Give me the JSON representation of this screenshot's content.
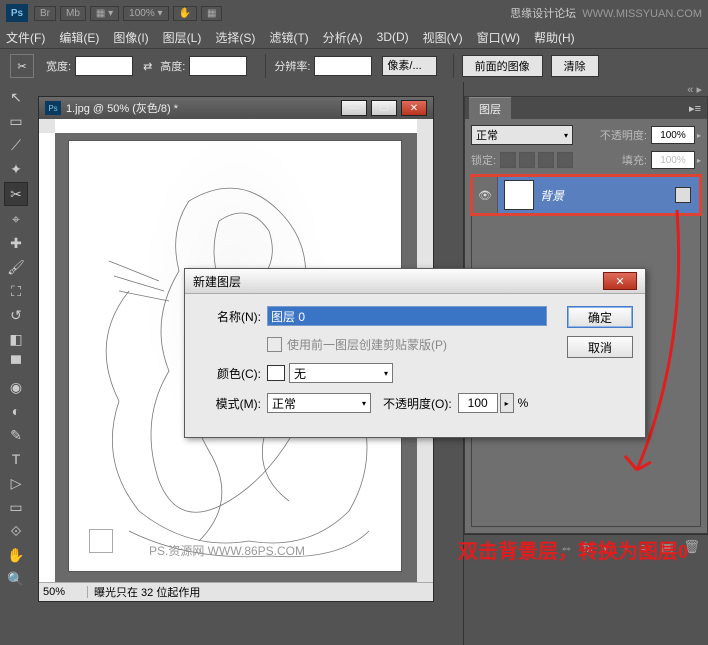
{
  "app": {
    "br": "Br",
    "mb": "Mb",
    "zoom": "100%",
    "forum": "思缘设计论坛",
    "url": "WWW.MISSYUAN.COM"
  },
  "menu": {
    "file": "文件(F)",
    "edit": "编辑(E)",
    "image": "图像(I)",
    "layer": "图层(L)",
    "select": "选择(S)",
    "filter": "滤镜(T)",
    "analysis": "分析(A)",
    "threeD": "3D(D)",
    "view": "视图(V)",
    "window": "窗口(W)",
    "help": "帮助(H)"
  },
  "optbar": {
    "width": "宽度:",
    "height": "高度:",
    "res": "分辨率:",
    "unit": "像素/...",
    "front": "前面的图像",
    "clear": "清除"
  },
  "doc": {
    "title": "1.jpg @ 50% (灰色/8) *",
    "zoom": "50%",
    "status": "曝光只在 32 位起作用",
    "watermark": "PS.资源网   WWW.86PS.COM"
  },
  "layers": {
    "tab": "图层",
    "blend": "正常",
    "opacity_label": "不透明度:",
    "opacity": "100%",
    "lock_label": "锁定:",
    "fill_label": "填充:",
    "fill": "100%",
    "item_name": "背景"
  },
  "dialog": {
    "title": "新建图层",
    "name_label": "名称(N):",
    "name_value": "图层 0",
    "clip_label": "使用前一图层创建剪贴蒙版(P)",
    "color_label": "颜色(C):",
    "color_value": "无",
    "mode_label": "模式(M):",
    "mode_value": "正常",
    "opacity_label": "不透明度(O):",
    "opacity_value": "100",
    "pct": "%",
    "ok": "确定",
    "cancel": "取消"
  },
  "annotation": "双击背景层，转换为图层0"
}
